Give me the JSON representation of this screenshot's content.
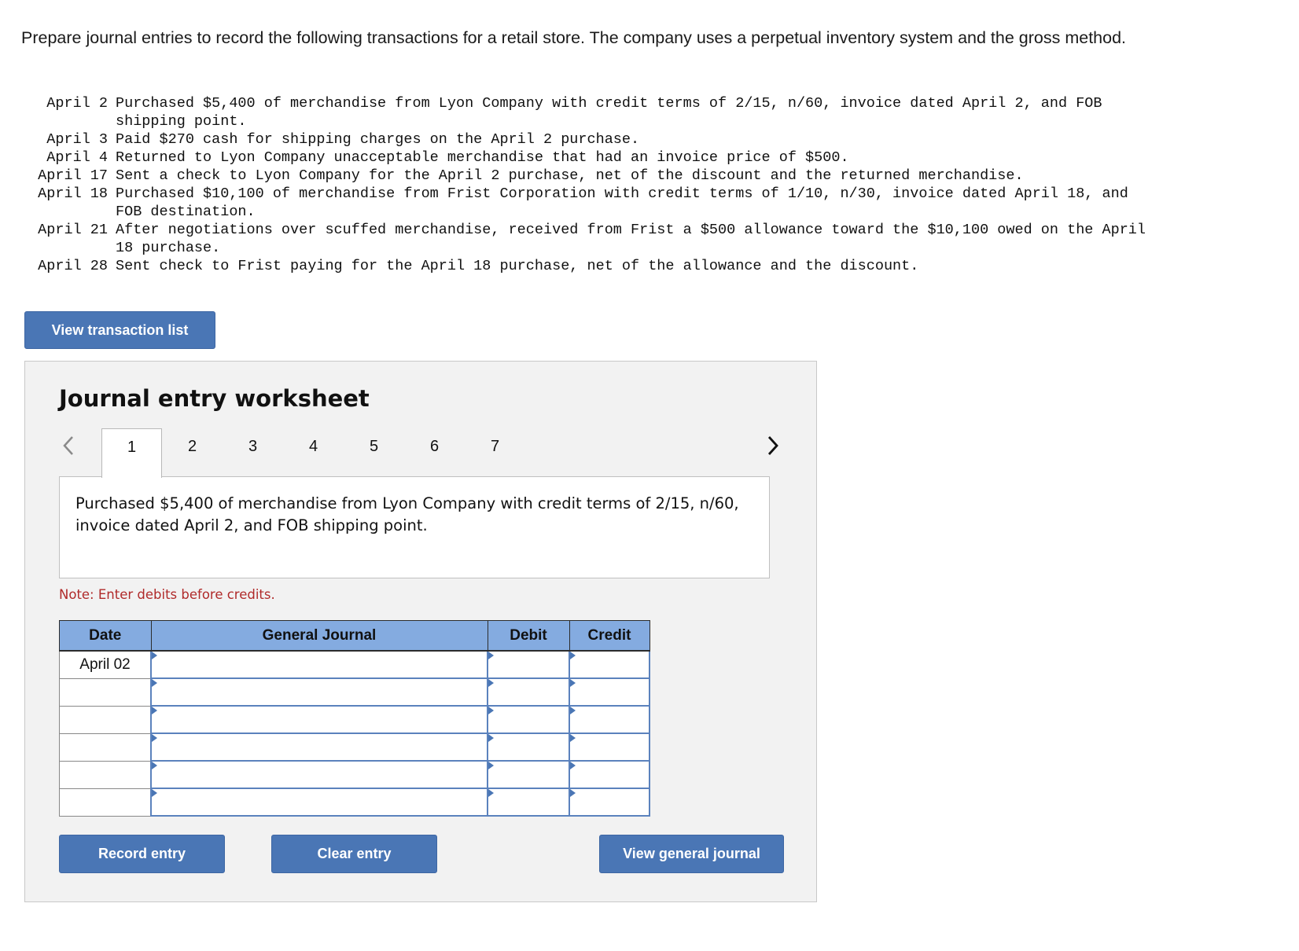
{
  "intro": "Prepare journal entries to record the following transactions for a retail store. The company uses a perpetual inventory system and the gross method.",
  "transactions": [
    {
      "date": "April 2",
      "text": "Purchased $5,400 of merchandise from Lyon Company with credit terms of 2/15, n/60, invoice dated April 2, and FOB shipping point."
    },
    {
      "date": "April 3",
      "text": "Paid $270 cash for shipping charges on the April 2 purchase."
    },
    {
      "date": "April 4",
      "text": "Returned to Lyon Company unacceptable merchandise that had an invoice price of $500."
    },
    {
      "date": "April 17",
      "text": "Sent a check to Lyon Company for the April 2 purchase, net of the discount and the returned merchandise."
    },
    {
      "date": "April 18",
      "text": "Purchased $10,100 of merchandise from Frist Corporation with credit terms of 1/10, n/30, invoice dated April 18, and FOB destination."
    },
    {
      "date": "April 21",
      "text": "After negotiations over scuffed merchandise, received from Frist a $500 allowance toward the $10,100 owed on the April 18 purchase."
    },
    {
      "date": "April 28",
      "text": "Sent check to Frist paying for the April 18 purchase, net of the allowance and the discount."
    }
  ],
  "buttons": {
    "view_transaction_list": "View transaction list",
    "record_entry": "Record entry",
    "clear_entry": "Clear entry",
    "view_general_journal": "View general journal"
  },
  "worksheet": {
    "title": "Journal entry worksheet",
    "prev_icon": "‹",
    "next_icon": "›",
    "tabs": [
      "1",
      "2",
      "3",
      "4",
      "5",
      "6",
      "7"
    ],
    "active_tab": "1",
    "description": "Purchased $5,400 of merchandise from Lyon Company with credit terms of 2/15, n/60, invoice dated April 2, and FOB shipping point.",
    "note": "Note: Enter debits before credits.",
    "columns": [
      "Date",
      "General Journal",
      "Debit",
      "Credit"
    ],
    "rows": [
      {
        "date": "April 02",
        "account": "",
        "debit": "",
        "credit": ""
      },
      {
        "date": "",
        "account": "",
        "debit": "",
        "credit": ""
      },
      {
        "date": "",
        "account": "",
        "debit": "",
        "credit": ""
      },
      {
        "date": "",
        "account": "",
        "debit": "",
        "credit": ""
      },
      {
        "date": "",
        "account": "",
        "debit": "",
        "credit": ""
      },
      {
        "date": "",
        "account": "",
        "debit": "",
        "credit": ""
      }
    ]
  }
}
